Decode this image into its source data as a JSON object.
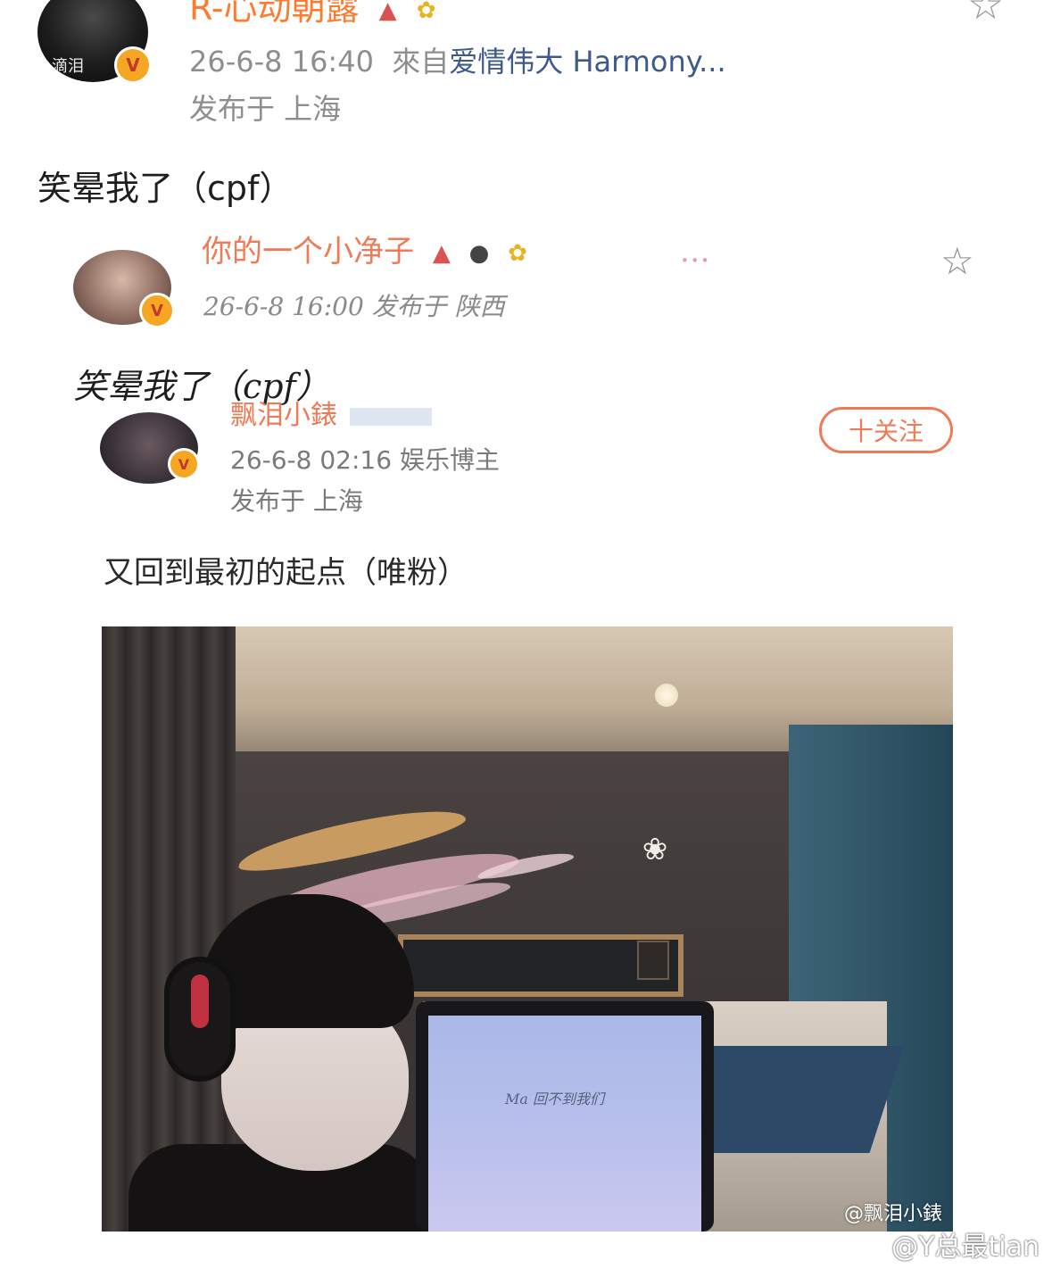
{
  "post": {
    "username": "R-心动朝露",
    "avatar_caption": "滴泪",
    "badge": "V",
    "timestamp": "26-6-8 16:40",
    "source_prefix": "來自",
    "source": "爱情伟大 Harmony...",
    "location": "发布于 上海",
    "text": "笑晕我了（cpf）",
    "emoji": [
      "red-hat-emoji",
      "sunflower-emoji"
    ],
    "favorite_icon": "☆"
  },
  "embedded_1": {
    "username": "你的一个小净子",
    "username_extra": "…",
    "badge": "V",
    "meta": "26-6-8 16:00  发布于 陕西",
    "text": "笑晕我了（cpf）",
    "emoji": [
      "red-hat-emoji",
      "panda-emoji",
      "sunflower-emoji"
    ],
    "favorite_icon": "☆"
  },
  "embedded_2": {
    "username": "飘泪小錶",
    "badge": "V",
    "follow_label": "十关注",
    "meta": "26-6-8 02:16  娱乐博主",
    "location": "发布于 上海",
    "text": "又回到最初的起点（唯粉）"
  },
  "photo": {
    "tablet_text": "Ma 回不到我们",
    "watermark": "@飘泪小錶"
  },
  "watermark": "@Y总最tian",
  "colors": {
    "username": "#ff7a2f",
    "meta": "#8e8e8e",
    "source_link": "#3d5a8a",
    "follow_accent": "#f07a55",
    "badge": "#f5a623"
  }
}
